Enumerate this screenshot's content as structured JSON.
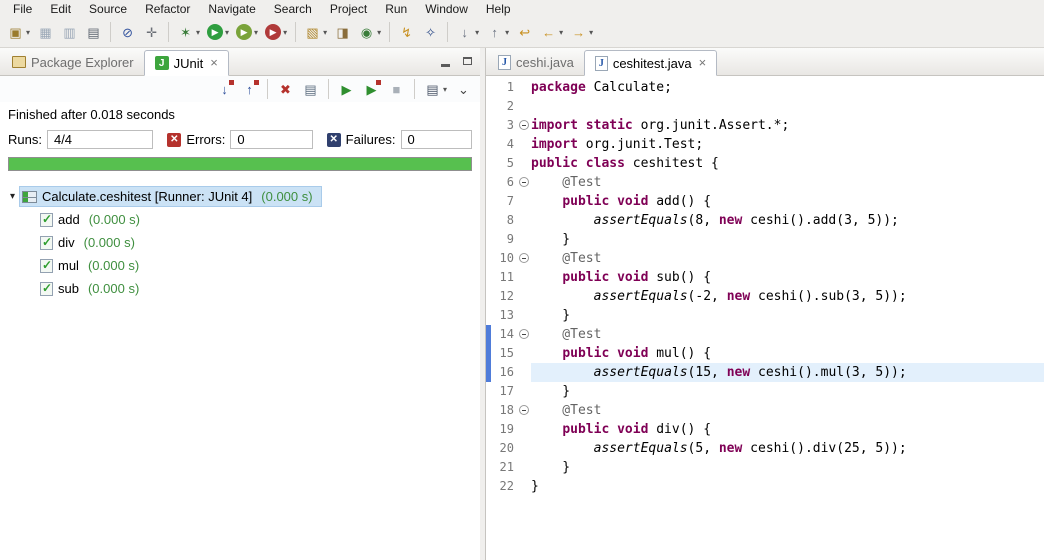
{
  "colors": {
    "keyword": "#7f0055",
    "annotation": "#646464",
    "line_number": "#787878",
    "current_line": "#e3f0fc",
    "success_green": "#57c04f",
    "time_green": "#3f8f3f",
    "selection_blue": "#cbe2f5",
    "error_red": "#b5322d",
    "failure_blue": "#30406e",
    "marker_blue": "#4f7cd9"
  },
  "icons": {
    "java_file": "J",
    "junit": "J",
    "close": "×",
    "expander": "▾",
    "error_x": "✕",
    "failure_x": "✕"
  },
  "menubar": {
    "items": [
      "File",
      "Edit",
      "Source",
      "Refactor",
      "Navigate",
      "Search",
      "Project",
      "Run",
      "Window",
      "Help"
    ]
  },
  "toolbar": {
    "items": [
      {
        "name": "new-wizard",
        "glyph": "▣",
        "color": "#9a7b2d",
        "dd": true
      },
      {
        "name": "save",
        "glyph": "▦",
        "color": "#9aa7b6"
      },
      {
        "name": "save-all",
        "glyph": "▥",
        "color": "#9aa7b6"
      },
      {
        "name": "print",
        "glyph": "▤",
        "color": "#5d6570"
      },
      {
        "sep": true
      },
      {
        "name": "skip-all-breakpoints",
        "glyph": "⊘",
        "color": "#33539e"
      },
      {
        "name": "build-all",
        "glyph": "✛",
        "color": "#6b6f76"
      },
      {
        "sep": true
      },
      {
        "name": "debug",
        "glyph": "✶",
        "color": "#3a7d3a",
        "dd": true
      },
      {
        "name": "run",
        "glyph": "▶",
        "bg": "#2f9e3f",
        "color": "#ffffff",
        "dd": true
      },
      {
        "name": "coverage",
        "glyph": "▶",
        "bg": "#7aa33a",
        "color": "#ffffff",
        "dd": true
      },
      {
        "name": "run-external-tools",
        "glyph": "▶",
        "bg": "#b03a3a",
        "color": "#ffffff",
        "dd": true
      },
      {
        "sep": true
      },
      {
        "name": "new-java-project",
        "glyph": "▧",
        "color": "#b08830",
        "dd": true
      },
      {
        "name": "new-java-package",
        "glyph": "◨",
        "color": "#8a6d3b"
      },
      {
        "name": "new-java-class",
        "glyph": "◉",
        "color": "#3a7d3a",
        "dd": true
      },
      {
        "sep": true
      },
      {
        "name": "open-type",
        "glyph": "↯",
        "color": "#c89020"
      },
      {
        "name": "search",
        "glyph": "✧",
        "color": "#2f4d8a"
      },
      {
        "sep": true
      },
      {
        "name": "next-annotation",
        "glyph": "↓",
        "color": "#6b7280",
        "dd": true
      },
      {
        "name": "previous-annotation",
        "glyph": "↑",
        "color": "#6b7280",
        "dd": true
      },
      {
        "name": "last-edit-location",
        "glyph": "↩",
        "color": "#c89020"
      },
      {
        "name": "back",
        "glyph": "←",
        "color": "#c89020",
        "dd": true
      },
      {
        "name": "forward",
        "glyph": "→",
        "color": "#c89020",
        "dd": true
      }
    ]
  },
  "left_panel": {
    "tabs": [
      {
        "label": "Package Explorer"
      },
      {
        "label": "JUnit"
      }
    ],
    "view_toolbar": [
      {
        "name": "next-failed-test",
        "glyph": "↓",
        "color": "#33539e",
        "badge": true
      },
      {
        "name": "previous-failed-test",
        "glyph": "↑",
        "color": "#33539e",
        "badge": true
      },
      {
        "sep": true
      },
      {
        "name": "show-failures-only",
        "glyph": "✖",
        "color": "#b5322d"
      },
      {
        "name": "show-skipped-tests",
        "glyph": "▤",
        "color": "#5a6b7d"
      },
      {
        "sep": true
      },
      {
        "name": "rerun-test",
        "glyph": "▶",
        "color": "#2f8f2f"
      },
      {
        "name": "rerun-failed-first",
        "glyph": "▶",
        "color": "#2f8f2f",
        "badge": true
      },
      {
        "name": "stop-test-session",
        "glyph": "■",
        "color": "#a9b0b8"
      },
      {
        "sep": true
      },
      {
        "name": "test-run-history",
        "glyph": "▤",
        "color": "#4a5568",
        "dd": true
      },
      {
        "name": "view-menu",
        "glyph": "⌄",
        "color": "#444444"
      }
    ],
    "status": "Finished after 0.018 seconds",
    "counters": {
      "runs_label": "Runs:",
      "runs_value": "4/4",
      "errors_label": "Errors:",
      "errors_value": "0",
      "failures_label": "Failures:",
      "failures_value": "0"
    },
    "progress": {
      "percent": 100
    },
    "tree": {
      "root": {
        "name": "Calculate.ceshitest [Runner: JUnit 4]",
        "time": "(0.000 s)"
      },
      "items": [
        {
          "name": "add",
          "time": "(0.000 s)"
        },
        {
          "name": "div",
          "time": "(0.000 s)"
        },
        {
          "name": "mul",
          "time": "(0.000 s)"
        },
        {
          "name": "sub",
          "time": "(0.000 s)"
        }
      ]
    }
  },
  "editor": {
    "tabs": [
      {
        "label": "ceshi.java"
      },
      {
        "label": "ceshitest.java"
      }
    ],
    "lines": [
      {
        "n": 1,
        "t": [
          [
            "k",
            "package"
          ],
          [
            "p",
            " Calculate;"
          ]
        ]
      },
      {
        "n": 2,
        "t": []
      },
      {
        "n": 3,
        "fold": true,
        "t": [
          [
            "k",
            "import static"
          ],
          [
            "p",
            " org.junit.Assert.*;"
          ]
        ]
      },
      {
        "n": 4,
        "t": [
          [
            "k",
            "import"
          ],
          [
            "p",
            " org.junit.Test;"
          ]
        ]
      },
      {
        "n": 5,
        "t": [
          [
            "k",
            "public class"
          ],
          [
            "p",
            " ceshitest {"
          ]
        ]
      },
      {
        "n": 6,
        "fold": true,
        "t": [
          [
            "a",
            "    @Test"
          ]
        ]
      },
      {
        "n": 7,
        "t": [
          [
            "p",
            "    "
          ],
          [
            "k",
            "public void"
          ],
          [
            "p",
            " add() {"
          ]
        ]
      },
      {
        "n": 8,
        "t": [
          [
            "p",
            "        "
          ],
          [
            "i",
            "assertEquals"
          ],
          [
            "p",
            "(8, "
          ],
          [
            "k",
            "new"
          ],
          [
            "p",
            " ceshi().add(3, 5));"
          ]
        ]
      },
      {
        "n": 9,
        "t": [
          [
            "p",
            "    }"
          ]
        ]
      },
      {
        "n": 10,
        "fold": true,
        "t": [
          [
            "a",
            "    @Test"
          ]
        ]
      },
      {
        "n": 11,
        "t": [
          [
            "p",
            "    "
          ],
          [
            "k",
            "public void"
          ],
          [
            "p",
            " sub() {"
          ]
        ]
      },
      {
        "n": 12,
        "t": [
          [
            "p",
            "        "
          ],
          [
            "i",
            "assertEquals"
          ],
          [
            "p",
            "(-2, "
          ],
          [
            "k",
            "new"
          ],
          [
            "p",
            " ceshi().sub(3, 5));"
          ]
        ]
      },
      {
        "n": 13,
        "t": [
          [
            "p",
            "    }"
          ]
        ]
      },
      {
        "n": 14,
        "fold": true,
        "mark": true,
        "t": [
          [
            "a",
            "    @Test"
          ]
        ]
      },
      {
        "n": 15,
        "mark": true,
        "t": [
          [
            "p",
            "    "
          ],
          [
            "k",
            "public void"
          ],
          [
            "p",
            " mul() {"
          ]
        ]
      },
      {
        "n": 16,
        "hl": true,
        "mark": true,
        "t": [
          [
            "p",
            "        "
          ],
          [
            "i",
            "assertEquals"
          ],
          [
            "p",
            "(15, "
          ],
          [
            "k",
            "new"
          ],
          [
            "p",
            " ceshi().mul(3, 5));"
          ]
        ]
      },
      {
        "n": 17,
        "t": [
          [
            "p",
            "    }"
          ]
        ]
      },
      {
        "n": 18,
        "fold": true,
        "t": [
          [
            "a",
            "    @Test"
          ]
        ]
      },
      {
        "n": 19,
        "t": [
          [
            "p",
            "    "
          ],
          [
            "k",
            "public void"
          ],
          [
            "p",
            " div() {"
          ]
        ]
      },
      {
        "n": 20,
        "t": [
          [
            "p",
            "        "
          ],
          [
            "i",
            "assertEquals"
          ],
          [
            "p",
            "(5, "
          ],
          [
            "k",
            "new"
          ],
          [
            "p",
            " ceshi().div(25, 5));"
          ]
        ]
      },
      {
        "n": 21,
        "t": [
          [
            "p",
            "    }"
          ]
        ]
      },
      {
        "n": 22,
        "t": [
          [
            "p",
            "}"
          ]
        ]
      }
    ]
  }
}
